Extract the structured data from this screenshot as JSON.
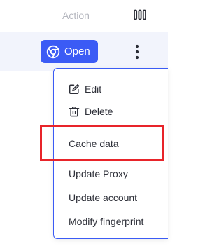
{
  "table": {
    "action_header": "Action",
    "columns_icon": "columns-settings-icon",
    "row": {
      "open_label": "Open",
      "browser_icon": "chrome-icon",
      "more_icon": "more-vertical-icon"
    }
  },
  "dropdown": {
    "items": [
      {
        "label": "Edit",
        "icon": "edit-icon"
      },
      {
        "label": "Delete",
        "icon": "trash-icon"
      },
      {
        "label": "Cache data",
        "icon": ""
      },
      {
        "label": "Update Proxy",
        "icon": ""
      },
      {
        "label": "Update account",
        "icon": ""
      },
      {
        "label": "Modify fingerprint",
        "icon": ""
      }
    ]
  },
  "colors": {
    "accent": "#3b5bf5",
    "highlight": "#e8242a",
    "row_selected_bg": "#f2f4fc",
    "header_text": "#b4b6be",
    "menu_text": "#2d2f38"
  }
}
